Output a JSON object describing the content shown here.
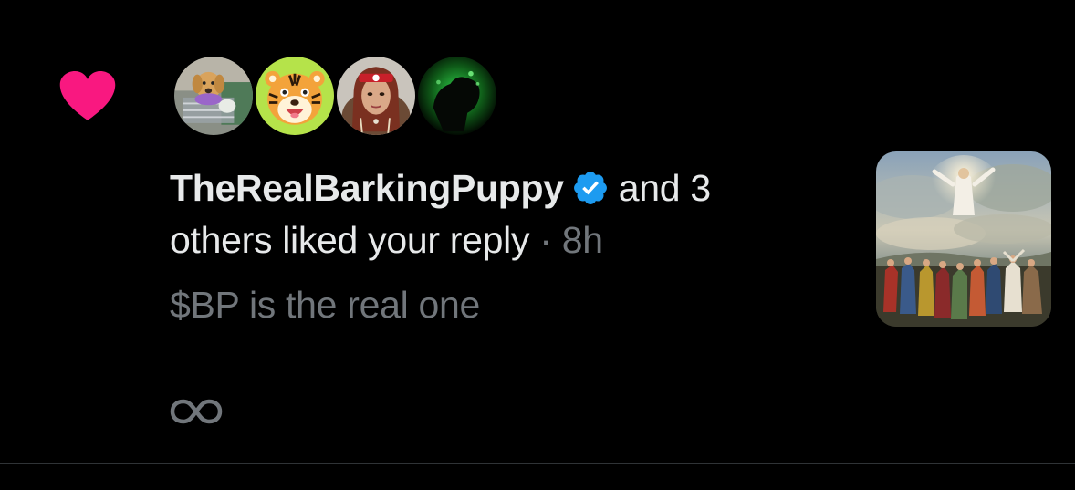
{
  "notification": {
    "type": "like",
    "icon": "heart-icon",
    "accent_color": "#f91880",
    "actor_name": "TheRealBarkingPuppy",
    "verified": true,
    "verified_color": "#1d9bf0",
    "text_after_name": "and 3",
    "text_line2": "others liked your reply",
    "separator": "·",
    "time_ago": "8h",
    "reply_text": "$BP is the real one",
    "avatars": [
      {
        "name": "avatar-puppy"
      },
      {
        "name": "avatar-tiger"
      },
      {
        "name": "avatar-woman"
      },
      {
        "name": "avatar-green-silhouette"
      }
    ],
    "thumbnail": {
      "icon": "ascension-painting-thumbnail"
    },
    "footer_icon": "infinity-icon"
  }
}
